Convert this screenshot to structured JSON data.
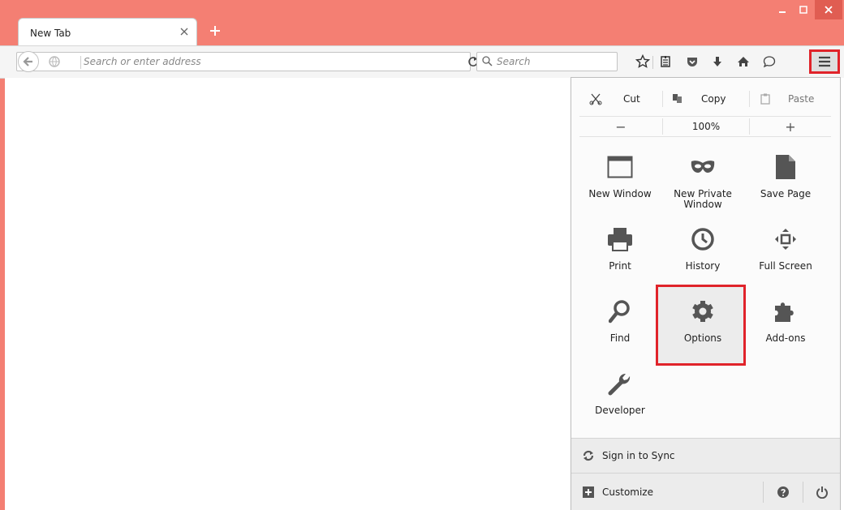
{
  "tab": {
    "title": "New Tab"
  },
  "urlbar": {
    "placeholder": "Search or enter address"
  },
  "searchbar": {
    "placeholder": "Search"
  },
  "menu": {
    "edit": {
      "cut": "Cut",
      "copy": "Copy",
      "paste": "Paste"
    },
    "zoom": {
      "minus": "−",
      "level": "100%",
      "plus": "+"
    },
    "items": [
      {
        "label": "New Window",
        "icon": "new-window-icon"
      },
      {
        "label": "New Private\nWindow",
        "icon": "private-mask-icon"
      },
      {
        "label": "Save Page",
        "icon": "save-page-icon"
      },
      {
        "label": "Print",
        "icon": "printer-icon"
      },
      {
        "label": "History",
        "icon": "clock-icon"
      },
      {
        "label": "Full Screen",
        "icon": "fullscreen-icon"
      },
      {
        "label": "Find",
        "icon": "magnifier-icon"
      },
      {
        "label": "Options",
        "icon": "gear-icon"
      },
      {
        "label": "Add-ons",
        "icon": "puzzle-icon"
      },
      {
        "label": "Developer",
        "icon": "wrench-icon"
      }
    ],
    "sync": "Sign in to Sync",
    "customize": "Customize"
  },
  "colors": {
    "titlebar": "#f47f73",
    "highlight": "#e0232a",
    "icon": "#555555"
  }
}
